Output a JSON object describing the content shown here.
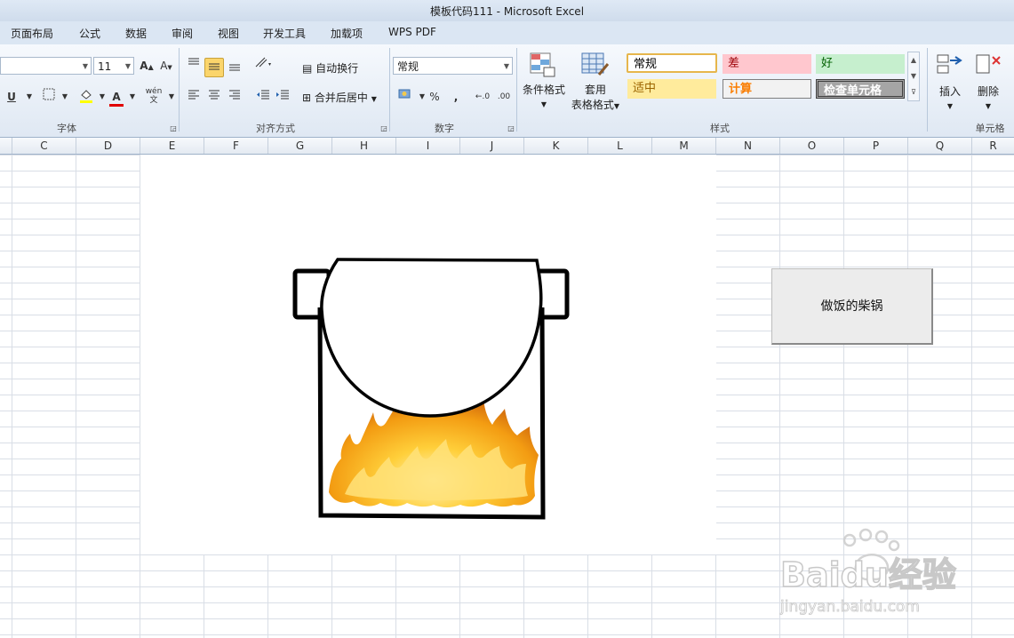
{
  "window": {
    "title": "模板代码111  -  Microsoft Excel"
  },
  "tabs": [
    "页面布局",
    "公式",
    "数据",
    "审阅",
    "视图",
    "开发工具",
    "加载项",
    "WPS PDF"
  ],
  "ribbon": {
    "font": {
      "size_value": "11",
      "group_label": "字体",
      "underline": "U",
      "font_color_label": "A",
      "phonetic_label": "wén"
    },
    "alignment": {
      "wrap_text": "自动换行",
      "merge_center": "合并后居中",
      "group_label": "对齐方式"
    },
    "number": {
      "format_value": "常规",
      "percent": "%",
      "comma": ",",
      "group_label": "数字"
    },
    "styles": {
      "conditional_format": "条件格式",
      "table_format_line1": "套用",
      "table_format_line2": "表格格式",
      "group_label": "样式",
      "cells": [
        {
          "label": "常规",
          "bg": "#ffffff",
          "color": "#000000"
        },
        {
          "label": "差",
          "bg": "#ffc7ce",
          "color": "#9c0006"
        },
        {
          "label": "好",
          "bg": "#c6efce",
          "color": "#006100"
        },
        {
          "label": "适中",
          "bg": "#ffeb9c",
          "color": "#9c6500"
        },
        {
          "label": "计算",
          "bg": "#f2f2f2",
          "color": "#fa7d00"
        },
        {
          "label": "检查单元格",
          "bg": "#a5a5a5",
          "color": "#ffffff"
        }
      ]
    },
    "cells": {
      "insert": "插入",
      "delete": "删除",
      "group_label": "单元格"
    }
  },
  "columns": [
    "C",
    "D",
    "E",
    "F",
    "G",
    "H",
    "I",
    "J",
    "K",
    "L",
    "M",
    "N",
    "O",
    "P",
    "Q",
    "R"
  ],
  "macro_button": {
    "label": "做饭的柴锅"
  },
  "watermark": {
    "brand": "Baidu经验",
    "url": "jingyan.baidu.com"
  },
  "colors": {
    "ribbon_bg": "#dfe8f3",
    "active_button": "#fbd56b",
    "grid_line": "#d9dee6",
    "fire_orange": "#f39c12"
  }
}
